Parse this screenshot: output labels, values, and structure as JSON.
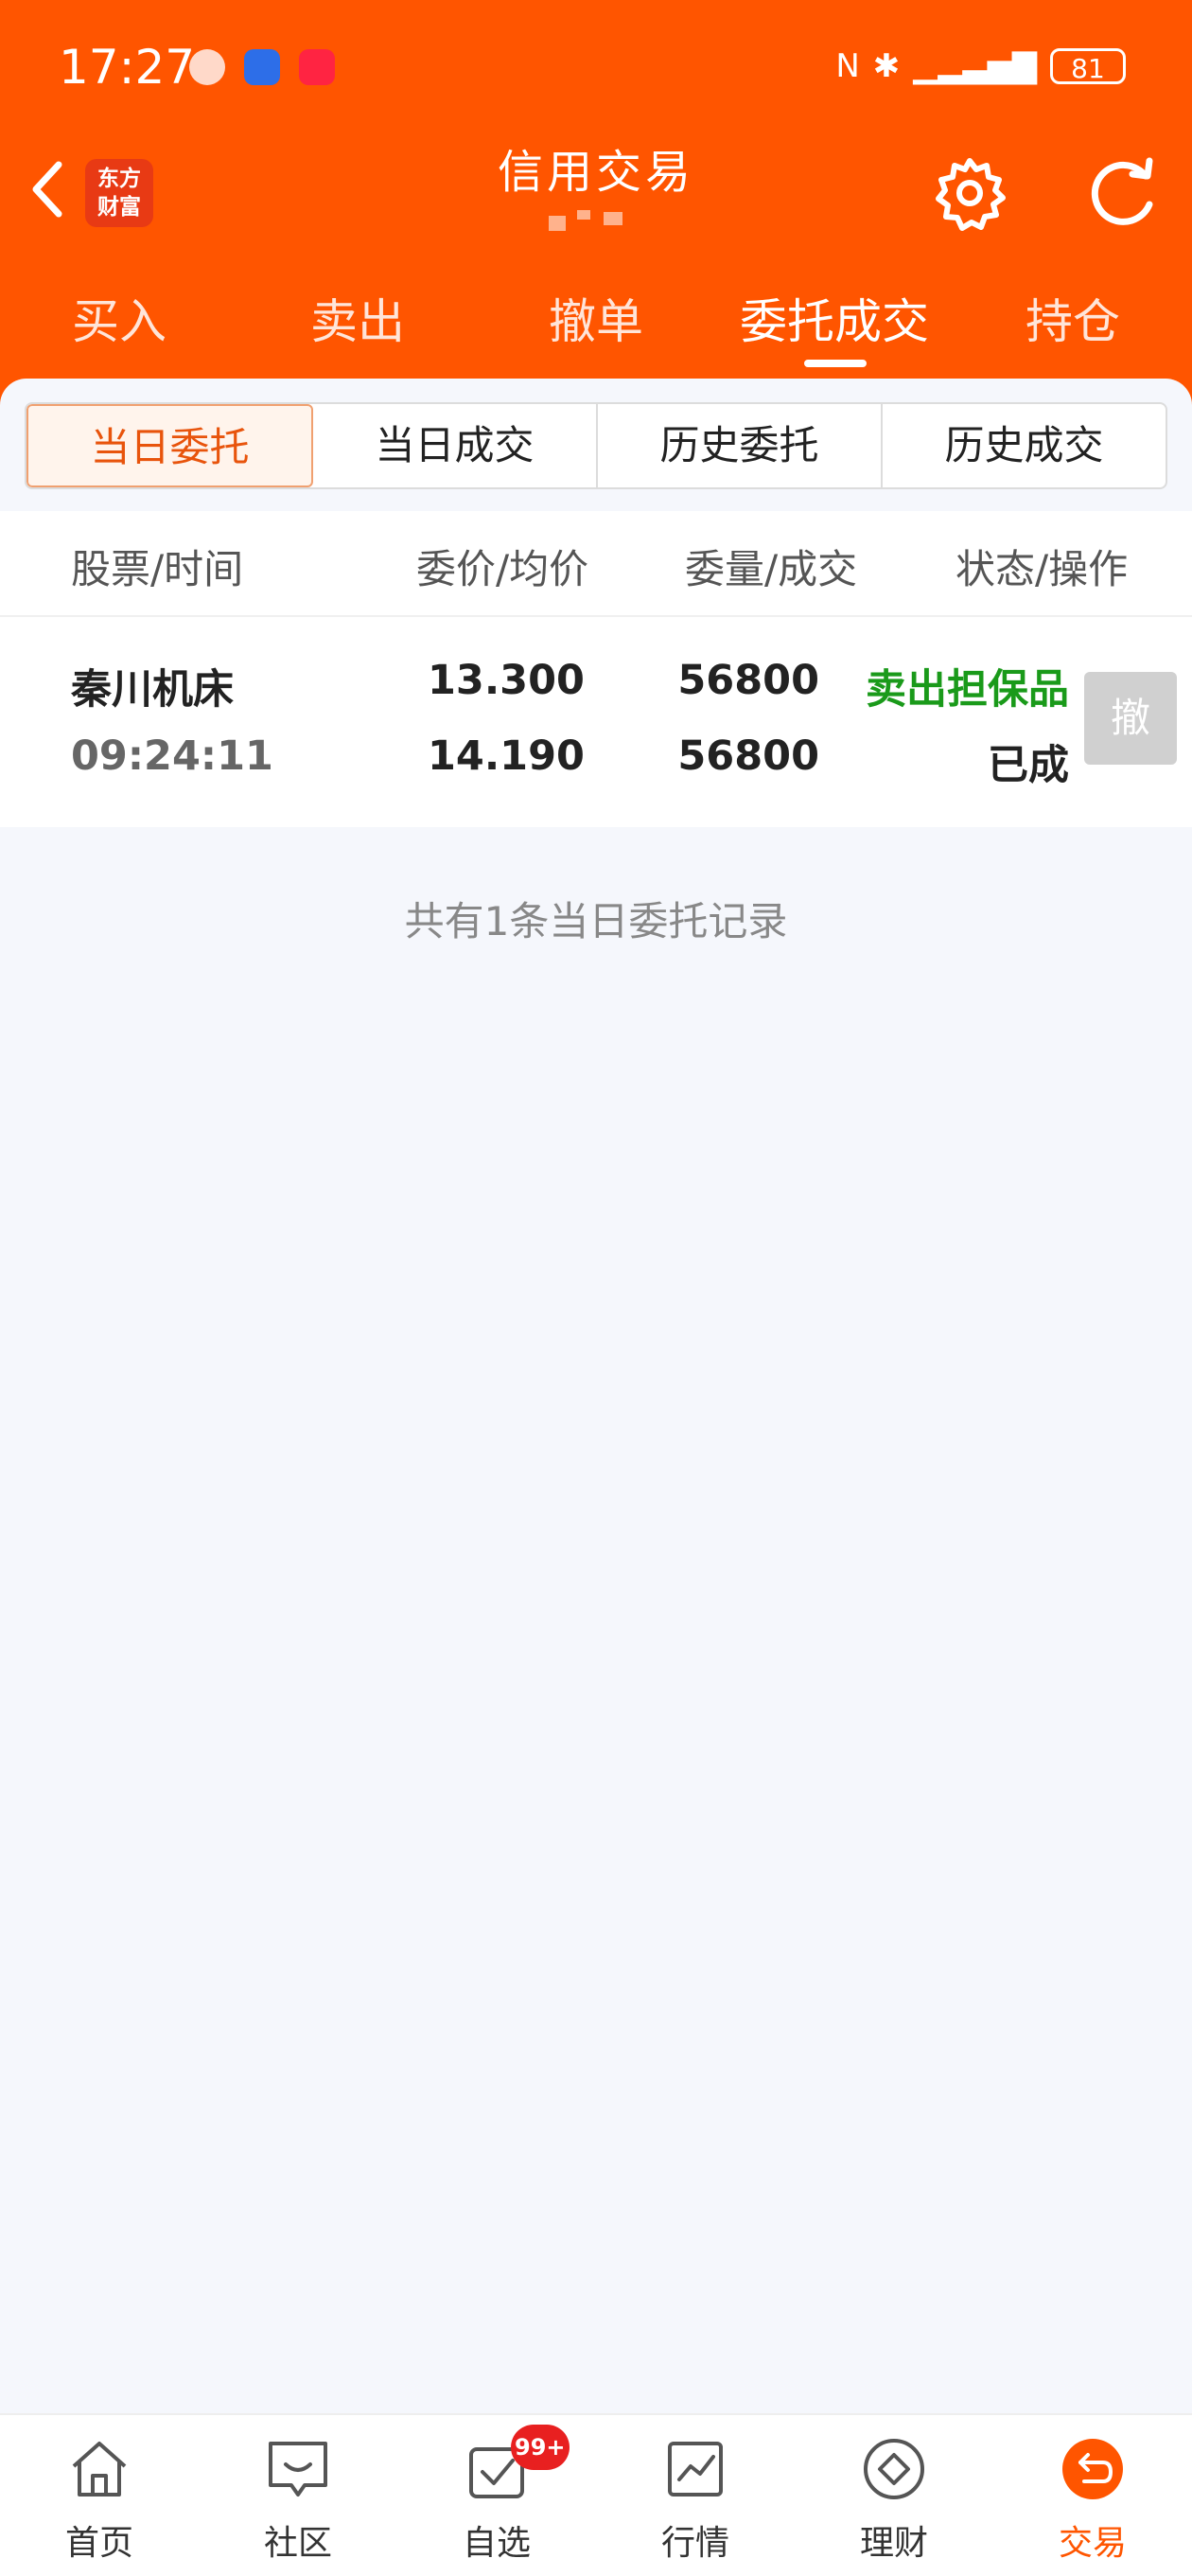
{
  "status_bar": {
    "time": "17:27",
    "battery": "81"
  },
  "header": {
    "logo_line1": "东方",
    "logo_line2": "财富",
    "title": "信用交易",
    "tabs": [
      {
        "label": "买入"
      },
      {
        "label": "卖出"
      },
      {
        "label": "撤单"
      },
      {
        "label": "委托成交"
      },
      {
        "label": "持仓"
      }
    ]
  },
  "segments": [
    {
      "label": "当日委托"
    },
    {
      "label": "当日成交"
    },
    {
      "label": "历史委托"
    },
    {
      "label": "历史成交"
    }
  ],
  "table": {
    "columns": [
      "股票/时间",
      "委价/均价",
      "委量/成交",
      "状态/操作"
    ],
    "rows": [
      {
        "stock": "秦川机床",
        "time": "09:24:11",
        "order_price": "13.300",
        "avg_price": "14.190",
        "order_qty": "56800",
        "filled_qty": "56800",
        "type": "卖出担保品",
        "status": "已成",
        "action": "撤"
      }
    ]
  },
  "summary": "共有1条当日委托记录",
  "bottom_nav": [
    {
      "label": "首页",
      "icon": "home-icon"
    },
    {
      "label": "社区",
      "icon": "community-icon"
    },
    {
      "label": "自选",
      "icon": "watchlist-icon",
      "badge": "99+"
    },
    {
      "label": "行情",
      "icon": "market-icon"
    },
    {
      "label": "理财",
      "icon": "wealth-icon"
    },
    {
      "label": "交易",
      "icon": "trade-icon"
    }
  ],
  "colors": {
    "brand": "#ff5500",
    "buy_sell_type": "#1a9a1a"
  }
}
